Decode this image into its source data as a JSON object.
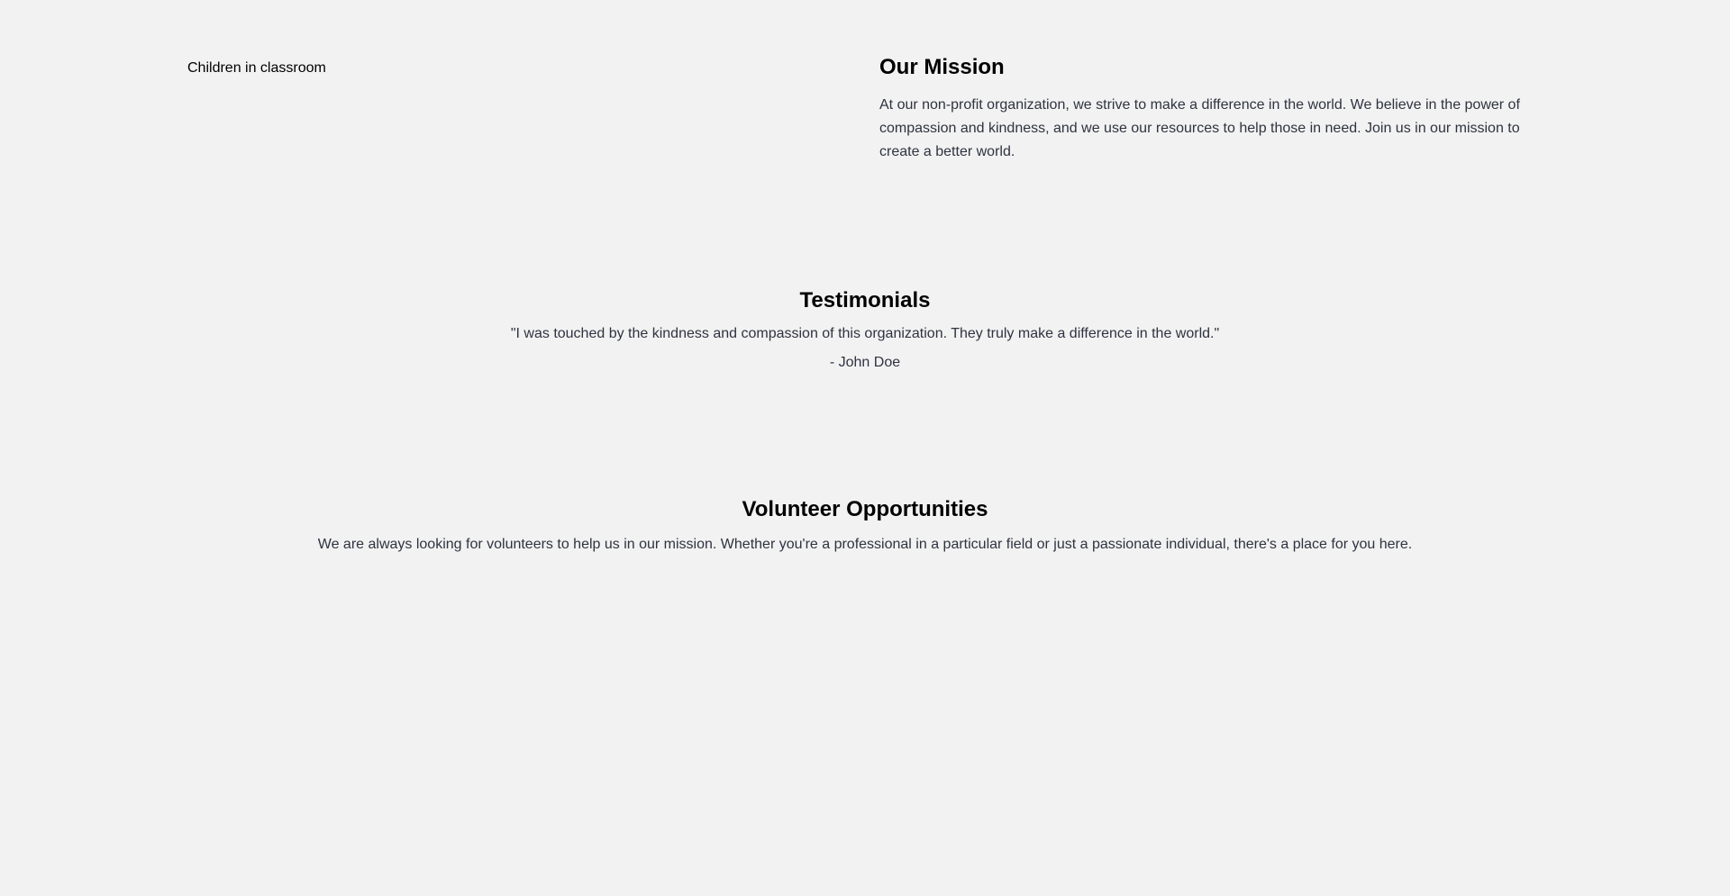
{
  "colors": {
    "page_background": "#f2f2f2",
    "heading_text": "#000000",
    "body_text": "#2f3340"
  },
  "mission": {
    "image_alt": "Children in classroom",
    "title": "Our Mission",
    "body": "At our non-profit organization, we strive to make a difference in the world. We believe in the power of compassion and kindness, and we use our resources to help those in need. Join us in our mission to create a better world."
  },
  "testimonials": {
    "title": "Testimonials",
    "quote": "\"I was touched by the kindness and compassion of this organization. They truly make a difference in the world.\"",
    "author": "- John Doe"
  },
  "volunteer": {
    "title": "Volunteer Opportunities",
    "body": "We are always looking for volunteers to help us in our mission. Whether you're a professional in a particular field or just a passionate individual, there's a place for you here."
  }
}
